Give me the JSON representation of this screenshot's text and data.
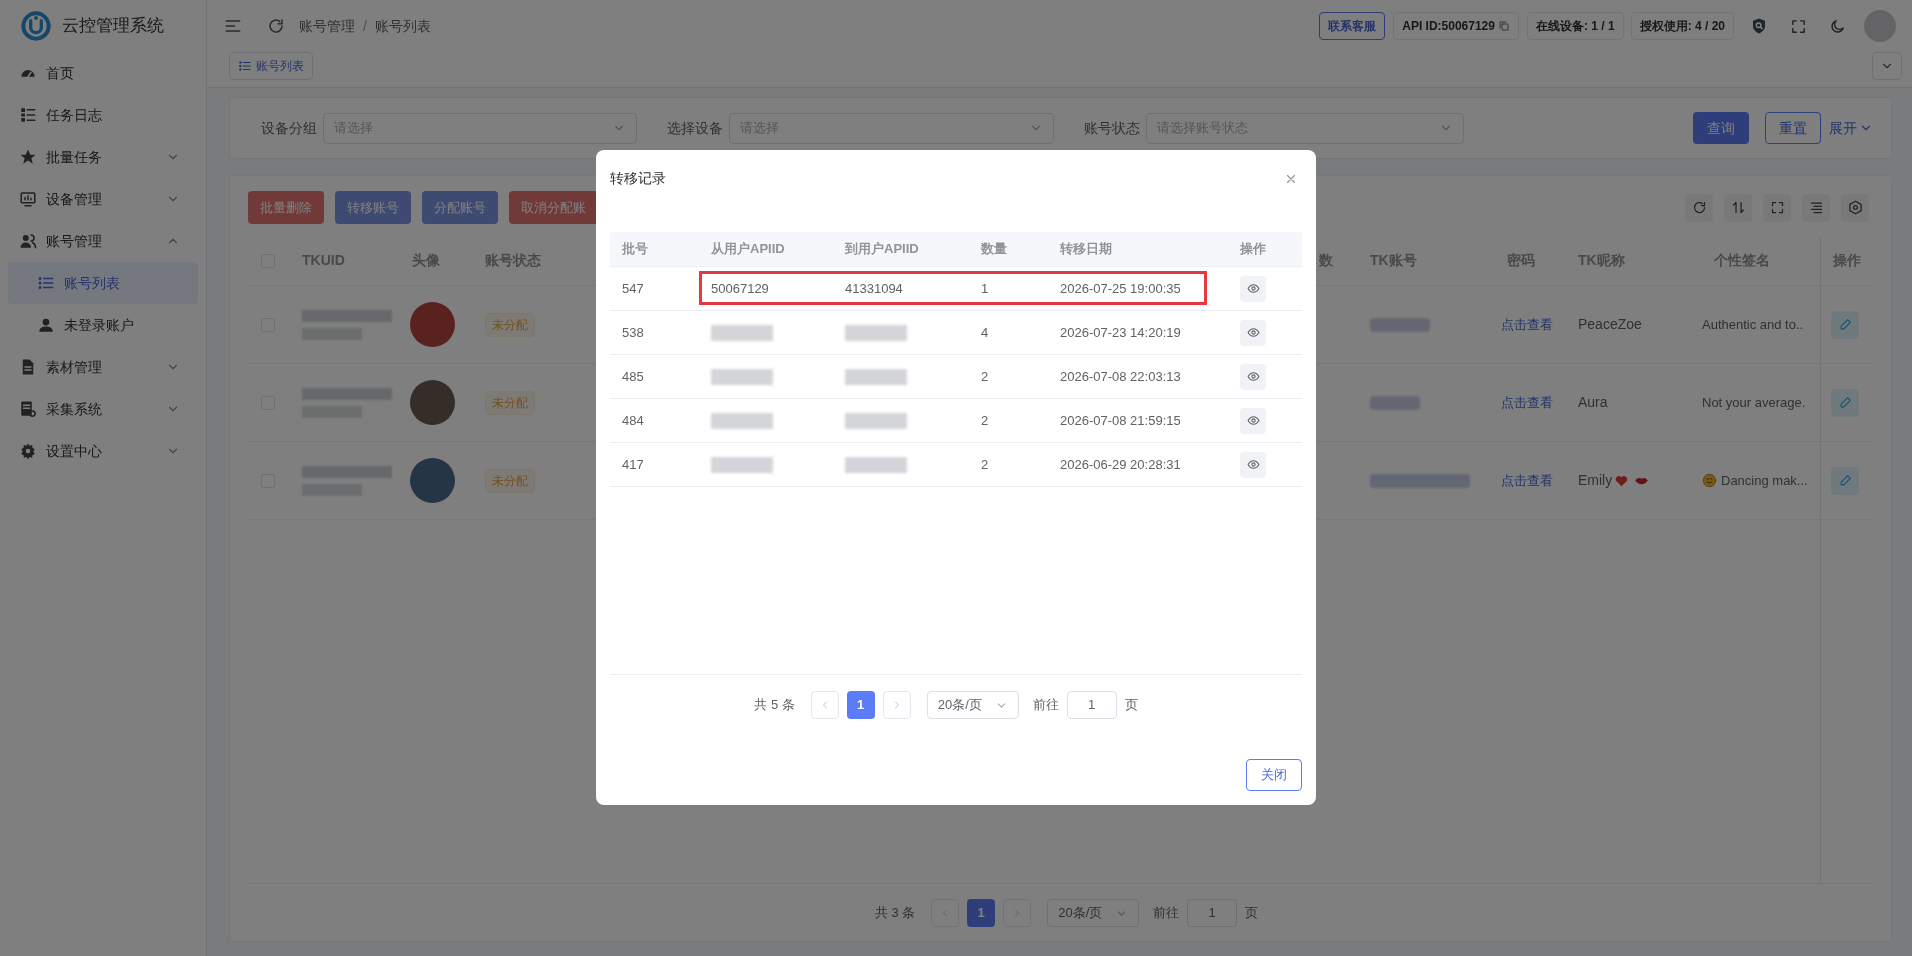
{
  "app": {
    "title": "云控管理系统"
  },
  "sidebar": {
    "items": [
      {
        "label": "首页",
        "selected": false
      },
      {
        "label": "任务日志",
        "selected": false
      },
      {
        "label": "批量任务",
        "selected": false,
        "expanded": false
      },
      {
        "label": "设备管理",
        "selected": false,
        "expanded": false
      },
      {
        "label": "账号管理",
        "selected": false,
        "expanded": true,
        "children": [
          {
            "label": "账号列表",
            "selected": true
          },
          {
            "label": "未登录账户",
            "selected": false
          }
        ]
      },
      {
        "label": "素材管理",
        "selected": false,
        "expanded": false
      },
      {
        "label": "采集系统",
        "selected": false,
        "expanded": false
      },
      {
        "label": "设置中心",
        "selected": false,
        "expanded": false
      }
    ]
  },
  "header": {
    "breadcrumb": [
      "账号管理",
      "账号列表"
    ],
    "breadcrumb_separator": "/",
    "contact_button": "联系客服",
    "api_id": "API ID:50067129",
    "online_devices": "在线设备: 1 / 1",
    "license_usage": "授权使用: 4 / 20"
  },
  "tabs": [
    {
      "label": "账号列表",
      "selected": true
    }
  ],
  "filters": {
    "fields": [
      {
        "label": "设备分组",
        "placeholder": "请选择"
      },
      {
        "label": "选择设备",
        "placeholder": "请选择"
      },
      {
        "label": "账号状态",
        "placeholder": "请选择账号状态"
      }
    ],
    "query_button": "查询",
    "reset_button": "重置",
    "expand_link": "展开"
  },
  "actions": [
    {
      "label": "批量删除",
      "kind": "danger",
      "disabled": true
    },
    {
      "label": "转移账号",
      "kind": "primary",
      "disabled": true
    },
    {
      "label": "分配账号",
      "kind": "primary",
      "disabled": true
    },
    {
      "label": "取消分配账",
      "kind": "danger",
      "disabled": true
    }
  ],
  "table": {
    "all_checked": false,
    "columns_left": [
      "TKUID",
      "头像",
      "账号状态"
    ],
    "columns_right": [
      "数",
      "TK账号",
      "密码",
      "TK昵称",
      "个性签名",
      "操作"
    ],
    "rows": [
      {
        "status": "未分配",
        "password": "点击查看",
        "nickname": "PeaceZoe",
        "signature": "Authentic and to..",
        "emoji": false,
        "checked": false
      },
      {
        "status": "未分配",
        "password": "点击查看",
        "nickname": "Aura",
        "signature": "Not your average.",
        "emoji": false,
        "checked": false
      },
      {
        "status": "未分配",
        "password": "点击查看",
        "nickname": "Emily",
        "signature": "Dancing mak...",
        "emoji": true,
        "checked": false
      }
    ]
  },
  "pagination": {
    "total": "共 3 条",
    "page": "1",
    "page_size": "20条/页",
    "goto": "前往",
    "goto_value": "1",
    "page_unit": "页"
  },
  "modal": {
    "title": "转移记录",
    "columns": [
      "批号",
      "从用户APIID",
      "到用户APIID",
      "数量",
      "转移日期",
      "操作"
    ],
    "rows": [
      {
        "batch": "547",
        "from": "50067129",
        "to": "41331094",
        "quantity": "1",
        "date": "2026-07-25 19:00:35",
        "redacted": false,
        "highlighted": true
      },
      {
        "batch": "538",
        "quantity": "4",
        "date": "2026-07-23 14:20:19",
        "redacted": true,
        "highlighted": false
      },
      {
        "batch": "485",
        "quantity": "2",
        "date": "2026-07-08 22:03:13",
        "redacted": true,
        "highlighted": false
      },
      {
        "batch": "484",
        "quantity": "2",
        "date": "2026-07-08 21:59:15",
        "redacted": true,
        "highlighted": false
      },
      {
        "batch": "417",
        "quantity": "2",
        "date": "2026-06-29 20:28:31",
        "redacted": true,
        "highlighted": false
      }
    ],
    "pagination": {
      "total": "共 5 条",
      "page": "1",
      "page_size": "20条/页",
      "goto": "前往",
      "goto_value": "1",
      "page_unit": "页"
    },
    "close_button": "关闭"
  }
}
